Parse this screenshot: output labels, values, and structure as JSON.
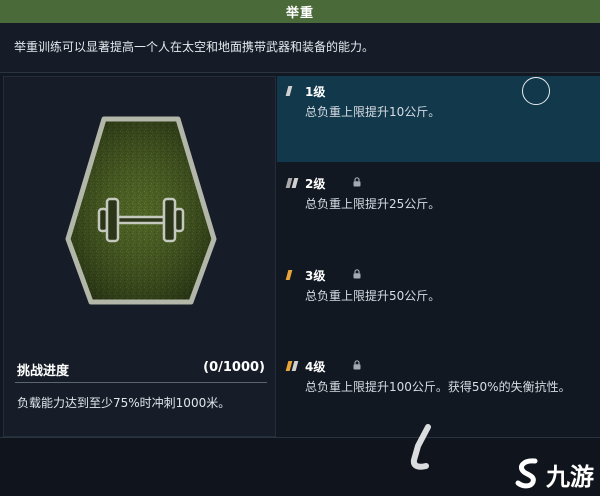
{
  "header": {
    "title": "举重"
  },
  "description": "举重训练可以显著提高一个人在太空和地面携带武器和装备的能力。",
  "badge": {
    "icon": "dumbbell-icon"
  },
  "challenge": {
    "label": "挑战进度",
    "progress": "(0/1000)",
    "requirement": "负载能力达到至少75%时冲刺1000米。"
  },
  "levels": [
    {
      "label": "1级",
      "effect": "总负重上限提升10公斤。",
      "locked": false,
      "selected": true,
      "rank_bars": [
        "#d0d0d0"
      ]
    },
    {
      "label": "2级",
      "effect": "总负重上限提升25公斤。",
      "locked": true,
      "selected": false,
      "rank_bars": [
        "#a9a9a9",
        "#d0d0d0"
      ]
    },
    {
      "label": "3级",
      "effect": "总负重上限提升50公斤。",
      "locked": true,
      "selected": false,
      "rank_bars": [
        "#e9a43a"
      ]
    },
    {
      "label": "4级",
      "effect": "总负重上限提升100公斤。获得50%的失衡抗性。",
      "locked": true,
      "selected": false,
      "rank_bars": [
        "#e9a43a",
        "#d0d0d0"
      ]
    }
  ],
  "icons": {
    "lock": "lock-icon",
    "rank": "rank-icon",
    "selection": "selection-ring-icon"
  },
  "colors": {
    "header": "#4b6a3a",
    "selected_row": "#11384b",
    "accent_orange": "#e9a43a"
  },
  "watermark": {
    "text": "九游"
  }
}
